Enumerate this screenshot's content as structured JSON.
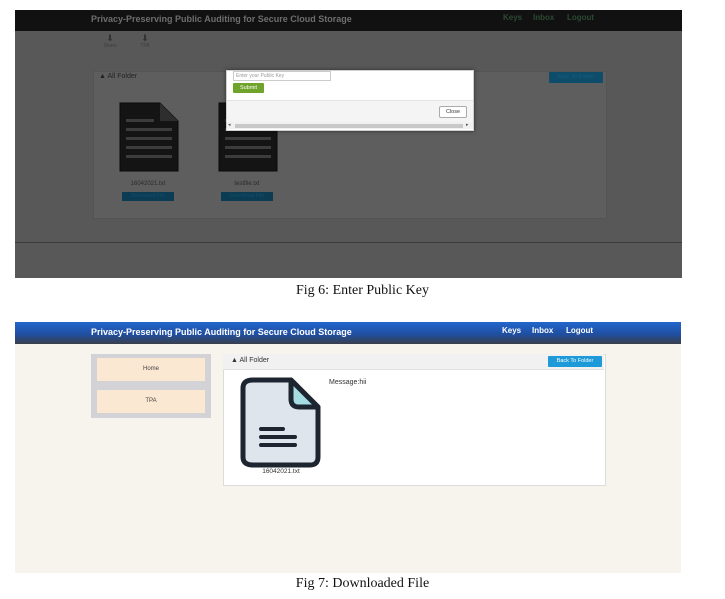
{
  "fig6": {
    "app_title": "Privacy-Preserving Public Auditing for Secure Cloud Storage",
    "nav": [
      "Keys",
      "Inbox",
      "Logout"
    ],
    "toolbar": [
      "Share",
      "TPA"
    ],
    "panel_title": "All Folder",
    "back_label": "Back To Folder",
    "files": [
      {
        "name": "16042021.txt",
        "download_label": "Download File"
      },
      {
        "name": "testfile.txt",
        "download_label": "Download File"
      }
    ],
    "modal": {
      "placeholder": "Enter your Public Key",
      "submit_label": "Submit",
      "close_label": "Close"
    },
    "caption": "Fig 6: Enter Public Key"
  },
  "fig7": {
    "app_title": "Privacy-Preserving Public Auditing for Secure Cloud Storage",
    "nav": [
      "Keys",
      "Inbox",
      "Logout"
    ],
    "sidebar": [
      "Home",
      "TPA"
    ],
    "panel_title": "All Folder",
    "back_label": "Back To Folder",
    "message": "Message:hii",
    "file_name": "16042021.txt",
    "caption": "Fig 7: Downloaded File"
  },
  "colors": {
    "brand_blue": "#2166cc",
    "action_blue": "#1e9ad9",
    "submit_green": "#6fa32c",
    "sidebar_item": "#fbe8d2"
  }
}
